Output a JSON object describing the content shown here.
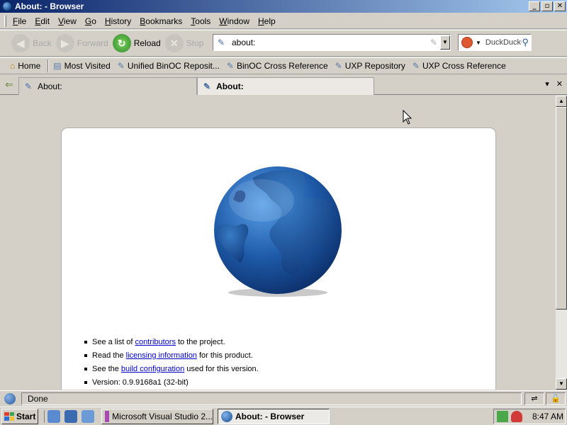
{
  "window": {
    "title": "About: - Browser",
    "controls": [
      "_",
      "▫",
      "✕"
    ]
  },
  "menu": [
    "File",
    "Edit",
    "View",
    "Go",
    "History",
    "Bookmarks",
    "Tools",
    "Window",
    "Help"
  ],
  "nav": {
    "back": "Back",
    "forward": "Forward",
    "reload": "Reload",
    "stop": "Stop",
    "url": "about:",
    "search_engine": "DuckDuckGo"
  },
  "bookmarks": [
    {
      "label": "Home",
      "icon": "home-icon"
    },
    {
      "label": "Most Visited",
      "icon": "folder-icon"
    },
    {
      "label": "Unified BinOC Reposit...",
      "icon": "page-icon"
    },
    {
      "label": "BinOC Cross Reference",
      "icon": "page-icon"
    },
    {
      "label": "UXP Repository",
      "icon": "page-icon"
    },
    {
      "label": "UXP Cross Reference",
      "icon": "page-icon"
    }
  ],
  "tabs": [
    {
      "label": "About:",
      "active": false
    },
    {
      "label": "About:",
      "active": true
    }
  ],
  "about": {
    "line1_pre": "See a list of",
    "line1_link": "contributors",
    "line1_post": "to the project.",
    "line2_pre": "Read the",
    "line2_link": "licensing information",
    "line2_post": "for this product.",
    "line3_pre": "See the",
    "line3_link": "build configuration",
    "line3_post": "used for this version.",
    "line4": "Version: 0.9.9168a1 (32-bit)"
  },
  "status": {
    "text": "Done"
  },
  "taskbar": {
    "start": "Start",
    "tasks": [
      {
        "label": "Microsoft Visual Studio 2...",
        "active": false
      },
      {
        "label": "About: - Browser",
        "active": true
      }
    ],
    "clock": "8:47 AM"
  },
  "colors": {
    "title_gradient_start": "#0a246a",
    "title_gradient_end": "#a6caf0",
    "chrome": "#d4d0c8",
    "link": "#0000cc"
  }
}
